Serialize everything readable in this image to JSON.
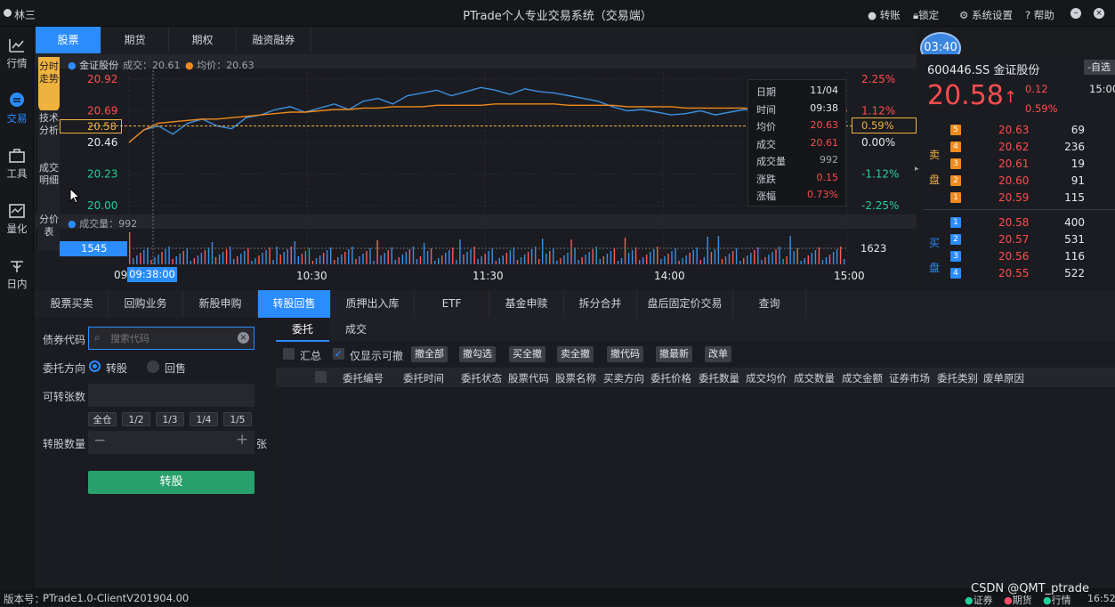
{
  "window": {
    "user": "林三",
    "title": "PTrade个人专业交易系统（交易端）",
    "toolbar": [
      {
        "icon": "info-icon",
        "label": "转账"
      },
      {
        "icon": "lock-icon",
        "label": "锁定"
      },
      {
        "icon": "gear-icon",
        "label": "系统设置"
      },
      {
        "icon": "help-icon",
        "label": "帮助"
      }
    ]
  },
  "sidebar": [
    {
      "label": "行情",
      "icon": "market-icon"
    },
    {
      "label": "交易",
      "icon": "trade-icon",
      "active": true
    },
    {
      "label": "工具",
      "icon": "toolbox-icon"
    },
    {
      "label": "量化",
      "icon": "quant-icon"
    },
    {
      "label": "日内",
      "icon": "intraday-icon"
    }
  ],
  "asset_tabs": [
    "股票",
    "期货",
    "期权",
    "融资融券"
  ],
  "chart_tabs": [
    {
      "label": "分时走势",
      "active": true
    },
    {
      "label": "技术分析"
    },
    {
      "label": "成交明细"
    },
    {
      "label": "分价表"
    }
  ],
  "chart": {
    "legend_name": "金证股份",
    "legend_price": "成交：20.61",
    "legend_avg": "均价：20.63",
    "volume_legend": "成交量：992",
    "price_box": "20.58",
    "pct_box": "0.59%",
    "vol_box": "1545",
    "vol_right": "1623",
    "time_box": "09:38:00",
    "time_prefix": "09"
  },
  "chart_data": {
    "type": "line",
    "xlabels": [
      "10:30",
      "11:30",
      "14:00",
      "15:00"
    ],
    "y_ticks": [
      "20.92",
      "20.69",
      "20.46",
      "20.23",
      "20.00"
    ],
    "pct_ticks": [
      "2.25%",
      "1.12%",
      "0.00%",
      "-1.12%",
      "-2.25%"
    ],
    "ylim": [
      20.0,
      20.92
    ],
    "series": [
      {
        "values": [
          20.46,
          20.55,
          20.58,
          20.52,
          20.6,
          20.63,
          20.58,
          20.56,
          20.64,
          20.66,
          20.7,
          20.72,
          20.68,
          20.71,
          20.74,
          20.7,
          20.76,
          20.78,
          20.74,
          20.8,
          20.82,
          20.84,
          20.8,
          20.83,
          20.86,
          20.84,
          20.81,
          20.85,
          20.83,
          20.82,
          20.8,
          20.78,
          20.76,
          20.72,
          20.69,
          20.7,
          20.68,
          20.66,
          20.67,
          20.69,
          20.66,
          20.68,
          20.7,
          20.67,
          20.66,
          20.64,
          20.62,
          20.6,
          20.62,
          20.61
        ]
      },
      {
        "values": [
          20.46,
          20.55,
          20.6,
          20.61,
          20.62,
          20.63,
          20.63,
          20.64,
          20.65,
          20.66,
          20.67,
          20.68,
          20.68,
          20.69,
          20.7,
          20.7,
          20.71,
          20.71,
          20.72,
          20.72,
          20.72,
          20.73,
          20.73,
          20.73,
          20.73,
          20.74,
          20.74,
          20.74,
          20.74,
          20.74,
          20.73,
          20.73,
          20.73,
          20.73,
          20.72,
          20.72,
          20.72,
          20.72,
          20.71,
          20.71,
          20.71,
          20.71,
          20.71,
          20.7,
          20.7,
          20.7,
          20.7,
          20.7,
          20.69,
          20.69
        ]
      }
    ]
  },
  "tooltip": [
    {
      "k": "日期",
      "v": "11/04",
      "c": "white"
    },
    {
      "k": "时间",
      "v": "09:38",
      "c": "white"
    },
    {
      "k": "均价",
      "v": "20.63",
      "c": "red"
    },
    {
      "k": "成交",
      "v": "20.61",
      "c": "red"
    },
    {
      "k": "成交量",
      "v": "992",
      "c": "gray"
    },
    {
      "k": "涨跌",
      "v": "0.15",
      "c": "red"
    },
    {
      "k": "涨幅",
      "v": "0.73%",
      "c": "red"
    }
  ],
  "clock": "03:40",
  "quote": {
    "code": "600446.SS 金证股份",
    "add_label": "-自选",
    "price": "20.58",
    "change": "0.12",
    "pct": "0.59%",
    "time": "15:00",
    "sell_label": [
      "卖",
      "盘"
    ],
    "buy_label": [
      "买",
      "盘"
    ],
    "asks": [
      {
        "n": "5",
        "p": "20.63",
        "v": "69"
      },
      {
        "n": "4",
        "p": "20.62",
        "v": "236"
      },
      {
        "n": "3",
        "p": "20.61",
        "v": "19"
      },
      {
        "n": "2",
        "p": "20.60",
        "v": "91"
      },
      {
        "n": "1",
        "p": "20.59",
        "v": "115"
      }
    ],
    "bids": [
      {
        "n": "1",
        "p": "20.58",
        "v": "400"
      },
      {
        "n": "2",
        "p": "20.57",
        "v": "531"
      },
      {
        "n": "3",
        "p": "20.56",
        "v": "116"
      },
      {
        "n": "4",
        "p": "20.55",
        "v": "522"
      }
    ]
  },
  "lower_tabs": [
    "股票买卖",
    "回购业务",
    "新股申购",
    "转股回售",
    "质押出入库",
    "ETF",
    "基金申赎",
    "拆分合并",
    "盘后固定价交易",
    "查询"
  ],
  "form": {
    "bond_code_label": "债券代码",
    "search_placeholder": "搜索代码",
    "direction_label": "委托方向",
    "opt_convert": "转股",
    "opt_sellback": "回售",
    "convertible_label": "可转张数",
    "fractions": [
      "全仓",
      "1/2",
      "1/3",
      "1/4",
      "1/5"
    ],
    "qty_label": "转股数量",
    "qty_unit": "张",
    "submit": "转股"
  },
  "orders": {
    "sub_tabs": [
      "委托",
      "成交"
    ],
    "summary": "汇总",
    "only_cancelable": "仅显示可撤",
    "actions": [
      "撤全部",
      "撤勾选",
      "买全撤",
      "卖全撤",
      "撤代码",
      "撤最新",
      "改单"
    ],
    "columns": [
      "委托编号",
      "委托时间",
      "委托状态",
      "股票代码",
      "股票名称",
      "买卖方向",
      "委托价格",
      "委托数量",
      "成交均价",
      "成交数量",
      "成交金额",
      "证券市场",
      "委托类别",
      "废单原因"
    ]
  },
  "status": {
    "version": "版本号：",
    "version_value": "PTrade1.0-ClientV201904.00",
    "watermark": "CSDN @QMT_ptrade",
    "indicators": [
      "证券",
      "期货",
      "行情"
    ],
    "time": "16:52"
  }
}
